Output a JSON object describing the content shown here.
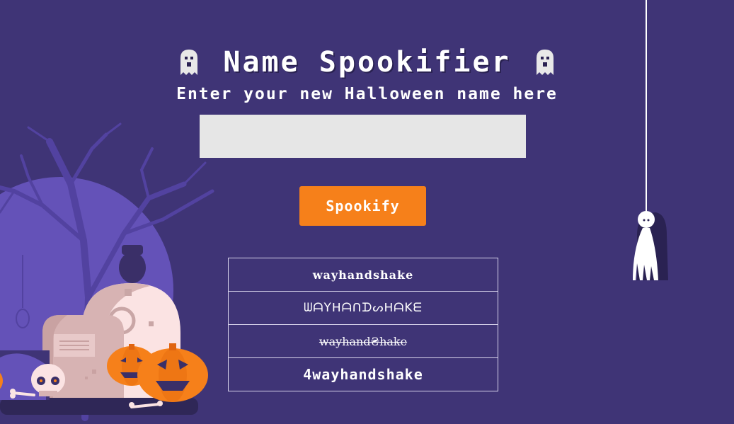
{
  "header": {
    "title": "Name Spookifier",
    "subtitle": "Enter your new Halloween name here",
    "left_icon": "ghost-icon",
    "right_icon": "ghost-icon"
  },
  "form": {
    "input_value": "",
    "input_placeholder": "",
    "button_label": "Spookify"
  },
  "results": [
    "wayhandshake",
    "ᗯᗩYᕼᗩᑎᗪᔕᕼᗩKᗴ",
    "wayhand₴hake",
    "4wayhandshake"
  ],
  "colors": {
    "background": "#3f3476",
    "button": "#f6801a",
    "input_bg": "#e6e6e6",
    "moon": "#6452b8",
    "pumpkin": "#f6801a"
  },
  "decorations": [
    "graveyard-illustration",
    "hanging-ghost-icon",
    "ghost-icon"
  ]
}
